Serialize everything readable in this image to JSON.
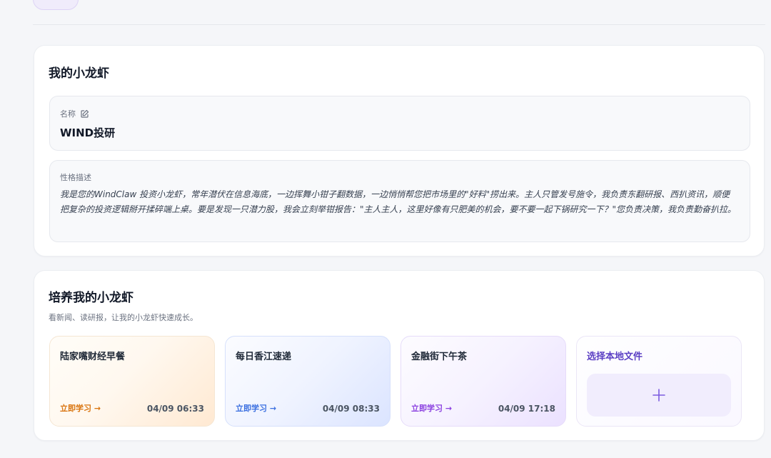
{
  "profile": {
    "title": "我的小龙虾",
    "name_label": "名称",
    "name_value": "WIND投研",
    "desc_label": "性格描述",
    "desc_value": "我是您的WindClaw 投资小龙虾，常年潜伏在信息海底，一边挥舞小钳子翻数据，一边悄悄帮您把市场里的\"好料\"捞出来。主人只管发号施令，我负责东翻研报、西扒资讯，顺便把复杂的投资逻辑掰开揉碎端上桌。要是发现一只潜力股，我会立刻举钳报告：\"主人主人，这里好像有只肥美的机会，要不要一起下锅研究一下？\"您负责决策，我负责勤奋扒拉。"
  },
  "training": {
    "title": "培养我的小龙虾",
    "subtitle": "看新闻、读研报，让我的小龙虾快速成长。",
    "tiles": [
      {
        "title": "陆家嘴财经早餐",
        "action": "立即学习 →",
        "time": "04/09 06:33",
        "accent": "#d9730d"
      },
      {
        "title": "每日香江速递",
        "action": "立即学习 →",
        "time": "04/09 08:33",
        "accent": "#3b6fe0"
      },
      {
        "title": "金融街下午茶",
        "action": "立即学习 →",
        "time": "04/09 17:18",
        "accent": "#8a3fe0"
      }
    ],
    "upload": {
      "title": "选择本地文件",
      "icon": "plus-icon"
    }
  },
  "icons": {
    "edit": "edit-icon"
  }
}
